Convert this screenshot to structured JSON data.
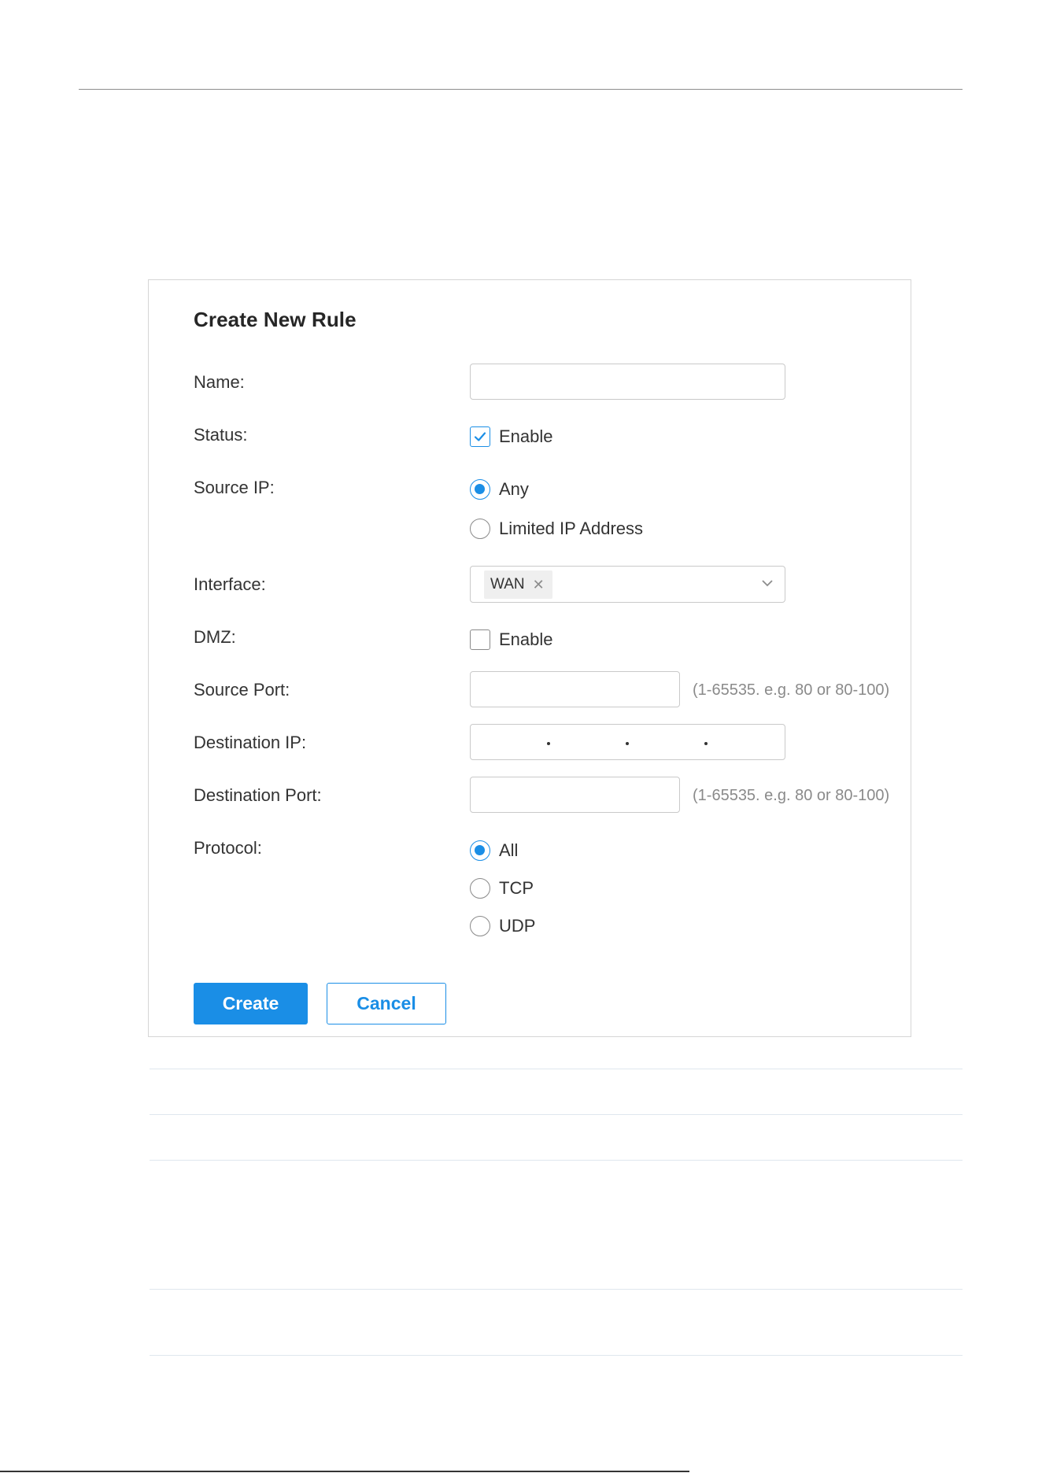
{
  "dialog": {
    "title": "Create New Rule",
    "fields": {
      "name": {
        "label": "Name:",
        "value": ""
      },
      "status": {
        "label": "Status:",
        "option": "Enable",
        "checked": true
      },
      "source_ip": {
        "label": "Source IP:",
        "options": [
          {
            "label": "Any",
            "selected": true
          },
          {
            "label": "Limited IP Address",
            "selected": false
          }
        ]
      },
      "interface": {
        "label": "Interface:",
        "tags": [
          "WAN"
        ]
      },
      "dmz": {
        "label": "DMZ:",
        "option": "Enable",
        "checked": false
      },
      "source_port": {
        "label": "Source Port:",
        "value": "",
        "hint": "(1-65535. e.g. 80 or 80-100)"
      },
      "destination_ip": {
        "label": "Destination IP:",
        "value": ""
      },
      "destination_port": {
        "label": "Destination Port:",
        "value": "",
        "hint": "(1-65535. e.g. 80 or 80-100)"
      },
      "protocol": {
        "label": "Protocol:",
        "options": [
          {
            "label": "All",
            "selected": true
          },
          {
            "label": "TCP",
            "selected": false
          },
          {
            "label": "UDP",
            "selected": false
          }
        ]
      }
    },
    "buttons": {
      "create": "Create",
      "cancel": "Cancel"
    }
  },
  "colors": {
    "accent": "#1a8ee6",
    "border": "#c9c9c9",
    "hint": "#8a8a8a"
  },
  "icons": [
    "check-icon",
    "close-icon",
    "chevron-down-icon"
  ]
}
